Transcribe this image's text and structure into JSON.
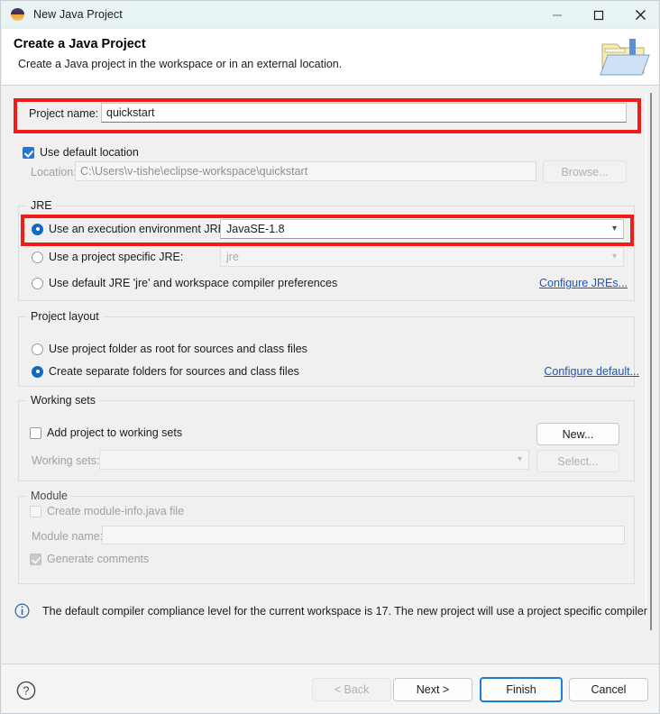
{
  "window": {
    "title": "New Java Project",
    "icon": "eclipse-icon",
    "controls": [
      {
        "name": "minimize",
        "glyph": "minimize-icon"
      },
      {
        "name": "maximize",
        "glyph": "maximize-icon"
      },
      {
        "name": "close",
        "glyph": "close-icon"
      }
    ]
  },
  "header": {
    "title": "Create a Java Project",
    "subtitle": "Create a Java project in the workspace or in an external location.",
    "icon": "new-java-project-folder-icon"
  },
  "project": {
    "name_label": "Project name:",
    "name_value": "quickstart",
    "use_default_location_label": "Use default location",
    "use_default_location_checked": true,
    "location_label": "Location:",
    "location_value": "C:\\Users\\v-tishe\\eclipse-workspace\\quickstart",
    "browse_label": "Browse..."
  },
  "jre": {
    "group_label": "JRE",
    "exec_env_label": "Use an execution environment JRE:",
    "exec_env_selected": true,
    "exec_env_value": "JavaSE-1.8",
    "project_specific_label": "Use a project specific JRE:",
    "project_specific_selected": false,
    "project_specific_value": "jre",
    "default_jre_label": "Use default JRE 'jre' and workspace compiler preferences",
    "default_jre_selected": false,
    "configure_link": "Configure JREs..."
  },
  "layout": {
    "group_label": "Project layout",
    "option_root_label": "Use project folder as root for sources and class files",
    "option_root_selected": false,
    "option_separate_label": "Create separate folders for sources and class files",
    "option_separate_selected": true,
    "configure_link": "Configure default..."
  },
  "working_sets": {
    "group_label": "Working sets",
    "add_label": "Add project to working sets",
    "add_checked": false,
    "sets_label": "Working sets:",
    "sets_value": "",
    "new_label": "New...",
    "select_label": "Select..."
  },
  "module": {
    "group_label": "Module",
    "create_module_info_label": "Create module-info.java file",
    "create_module_info_checked": false,
    "module_name_label": "Module name:",
    "module_name_value": "",
    "generate_comments_label": "Generate comments",
    "generate_comments_checked": true
  },
  "status": {
    "icon": "info-icon",
    "message": "The default compiler compliance level for the current workspace is 17. The new project will use a project specific compiler"
  },
  "footer": {
    "help_icon": "help-icon",
    "back_label": "< Back",
    "back_enabled": false,
    "next_label": "Next >",
    "finish_label": "Finish",
    "cancel_label": "Cancel"
  },
  "annotations": {
    "accent_color": "#ef1c1c",
    "boxes": [
      {
        "name": "project-name-highlight"
      },
      {
        "name": "jre-execution-environment-highlight"
      }
    ]
  }
}
